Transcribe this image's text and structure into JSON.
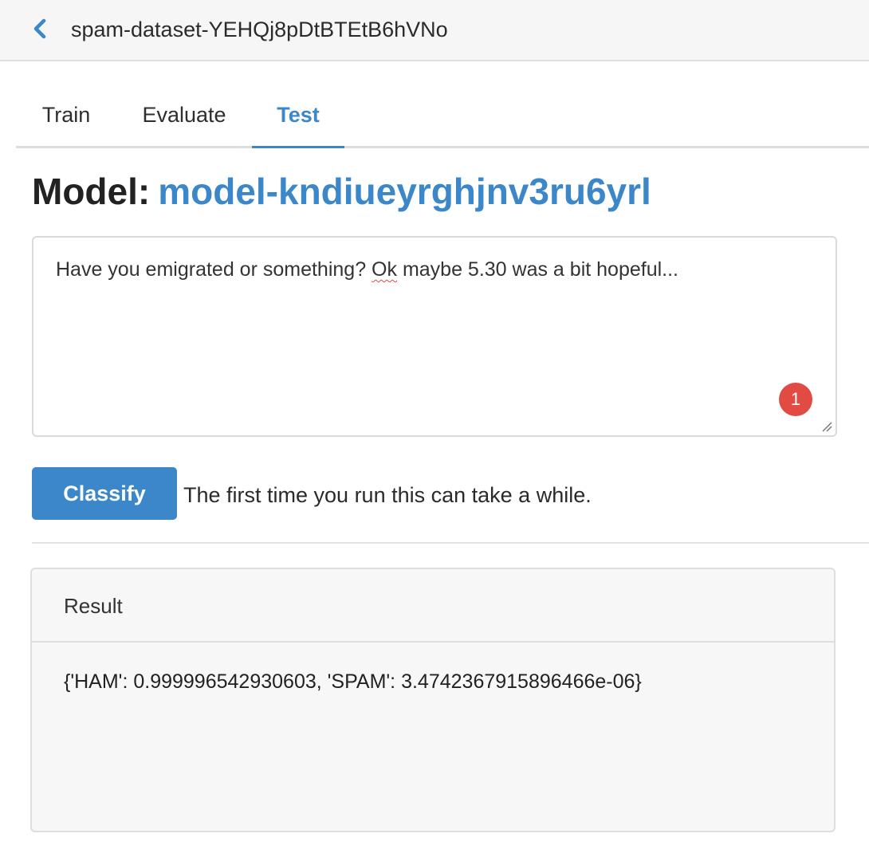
{
  "header": {
    "back_icon": "chevron-left-icon",
    "dataset_name": "spam-dataset-YEHQj8pDtBTEtB6hVNo",
    "accent_color": "#3b87c9"
  },
  "tabs": [
    {
      "label": "Train",
      "active": false
    },
    {
      "label": "Evaluate",
      "active": false
    },
    {
      "label": "Test",
      "active": true
    }
  ],
  "model": {
    "prefix": "Model:",
    "name": "model-kndiueyrghjnv3ru6yrl"
  },
  "input": {
    "text_before": "Have you emigrated or something? ",
    "misspelled_word": "Ok",
    "text_after": " maybe 5.30 was a bit hopeful...",
    "badge_count": "1",
    "badge_color": "#e14b44"
  },
  "actions": {
    "classify_label": "Classify",
    "hint": "The first time you run this can take a while."
  },
  "result": {
    "title": "Result",
    "value": "{'HAM': 0.999996542930603, 'SPAM': 3.4742367915896466e-06}"
  }
}
